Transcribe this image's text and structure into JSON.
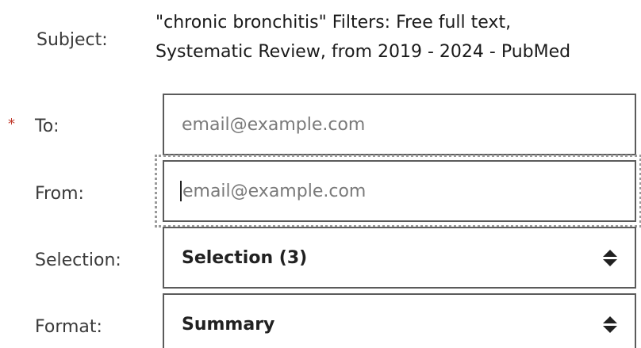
{
  "subject": {
    "label": "Subject:",
    "line1": "\"chronic bronchitis\" Filters: Free full text,",
    "line2": "Systematic Review, from 2019 - 2024 - PubMed"
  },
  "to": {
    "required_mark": "*",
    "label": "To:",
    "placeholder": "email@example.com",
    "value": ""
  },
  "from": {
    "label": "From:",
    "placeholder": "email@example.com",
    "value": ""
  },
  "selection": {
    "label": "Selection:",
    "value": "Selection (3)"
  },
  "format": {
    "label": "Format:",
    "value": "Summary"
  },
  "colors": {
    "required": "#c0392b",
    "border": "#5b5b5b",
    "placeholder": "#7a7a7a"
  },
  "icons": {
    "select_indicator": "sort-arrows-icon"
  }
}
